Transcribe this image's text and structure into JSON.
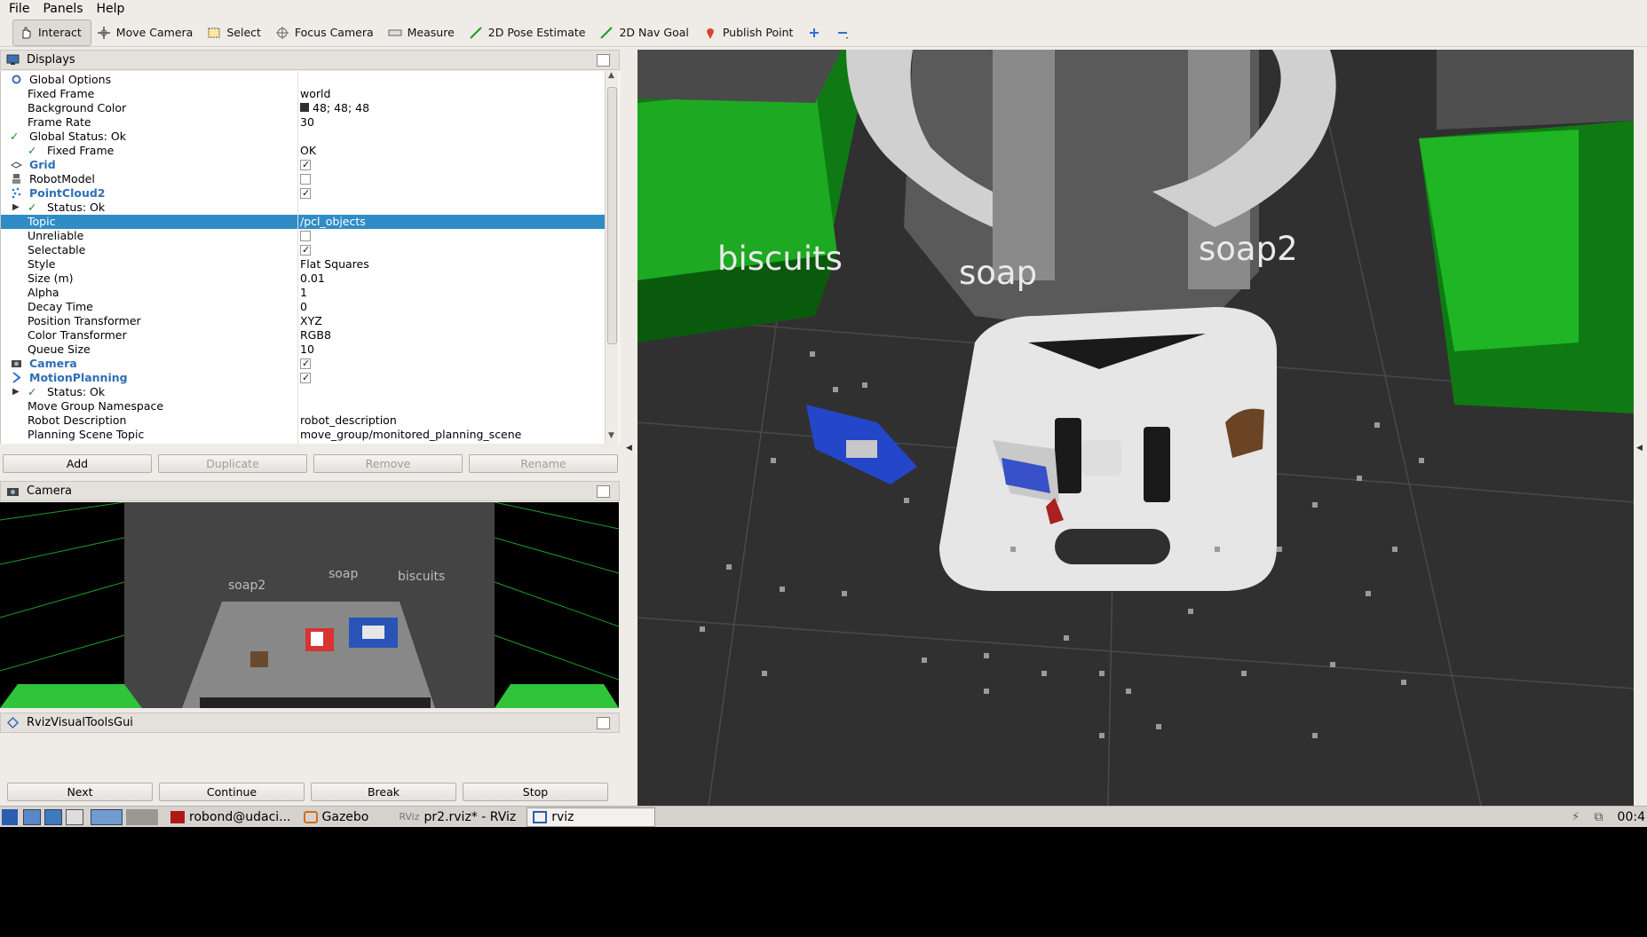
{
  "menu": [
    "File",
    "Panels",
    "Help"
  ],
  "toolbar": [
    {
      "label": "Interact",
      "icon": "hand-icon"
    },
    {
      "label": "Move Camera",
      "icon": "move-camera-icon"
    },
    {
      "label": "Select",
      "icon": "select-icon"
    },
    {
      "label": "Focus Camera",
      "icon": "focus-camera-icon"
    },
    {
      "label": "Measure",
      "icon": "ruler-icon"
    },
    {
      "label": "2D Pose Estimate",
      "icon": "pose-arrow-icon"
    },
    {
      "label": "2D Nav Goal",
      "icon": "nav-goal-arrow-icon"
    },
    {
      "label": "Publish Point",
      "icon": "map-pin-icon"
    }
  ],
  "displays": {
    "title": "Displays",
    "rows": [
      {
        "label": "Global Options",
        "value": ""
      },
      {
        "label": "Fixed Frame",
        "value": "world"
      },
      {
        "label": "Background Color",
        "value": "48; 48; 48"
      },
      {
        "label": "Frame Rate",
        "value": "30"
      },
      {
        "label": "Global Status: Ok",
        "value": ""
      },
      {
        "label": "Fixed Frame",
        "value": "OK"
      },
      {
        "label": "Grid",
        "value": ""
      },
      {
        "label": "RobotModel",
        "value": ""
      },
      {
        "label": "PointCloud2",
        "value": ""
      },
      {
        "label": "Status: Ok",
        "value": ""
      },
      {
        "label": "Topic",
        "value": "/pcl_objects"
      },
      {
        "label": "Unreliable",
        "value": ""
      },
      {
        "label": "Selectable",
        "value": ""
      },
      {
        "label": "Style",
        "value": "Flat Squares"
      },
      {
        "label": "Size (m)",
        "value": "0.01"
      },
      {
        "label": "Alpha",
        "value": "1"
      },
      {
        "label": "Decay Time",
        "value": "0"
      },
      {
        "label": "Position Transformer",
        "value": "XYZ"
      },
      {
        "label": "Color Transformer",
        "value": "RGB8"
      },
      {
        "label": "Queue Size",
        "value": "10"
      },
      {
        "label": "Camera",
        "value": ""
      },
      {
        "label": "MotionPlanning",
        "value": ""
      },
      {
        "label": "Status: Ok",
        "value": ""
      },
      {
        "label": "Move Group Namespace",
        "value": ""
      },
      {
        "label": "Robot Description",
        "value": "robot_description"
      },
      {
        "label": "Planning Scene Topic",
        "value": "move_group/monitored_planning_scene"
      }
    ],
    "buttons": [
      "Add",
      "Duplicate",
      "Remove",
      "Rename"
    ]
  },
  "camera": {
    "title": "Camera",
    "labels": [
      "soap2",
      "soap",
      "biscuits"
    ]
  },
  "rviz_tools": {
    "title": "RvizVisualToolsGui",
    "buttons": [
      "Next",
      "Continue",
      "Break",
      "Stop"
    ]
  },
  "viewport": {
    "labels": [
      "biscuits",
      "soap",
      "soap2"
    ]
  },
  "taskbar": {
    "items": [
      "robond@udaci...",
      "Gazebo",
      "pr2.rviz* - RViz",
      "rviz"
    ],
    "clock": "00:4"
  },
  "colors": {
    "selection": "#308cc6",
    "grid_bg": "#303030",
    "bin_green": "#22c02a"
  }
}
